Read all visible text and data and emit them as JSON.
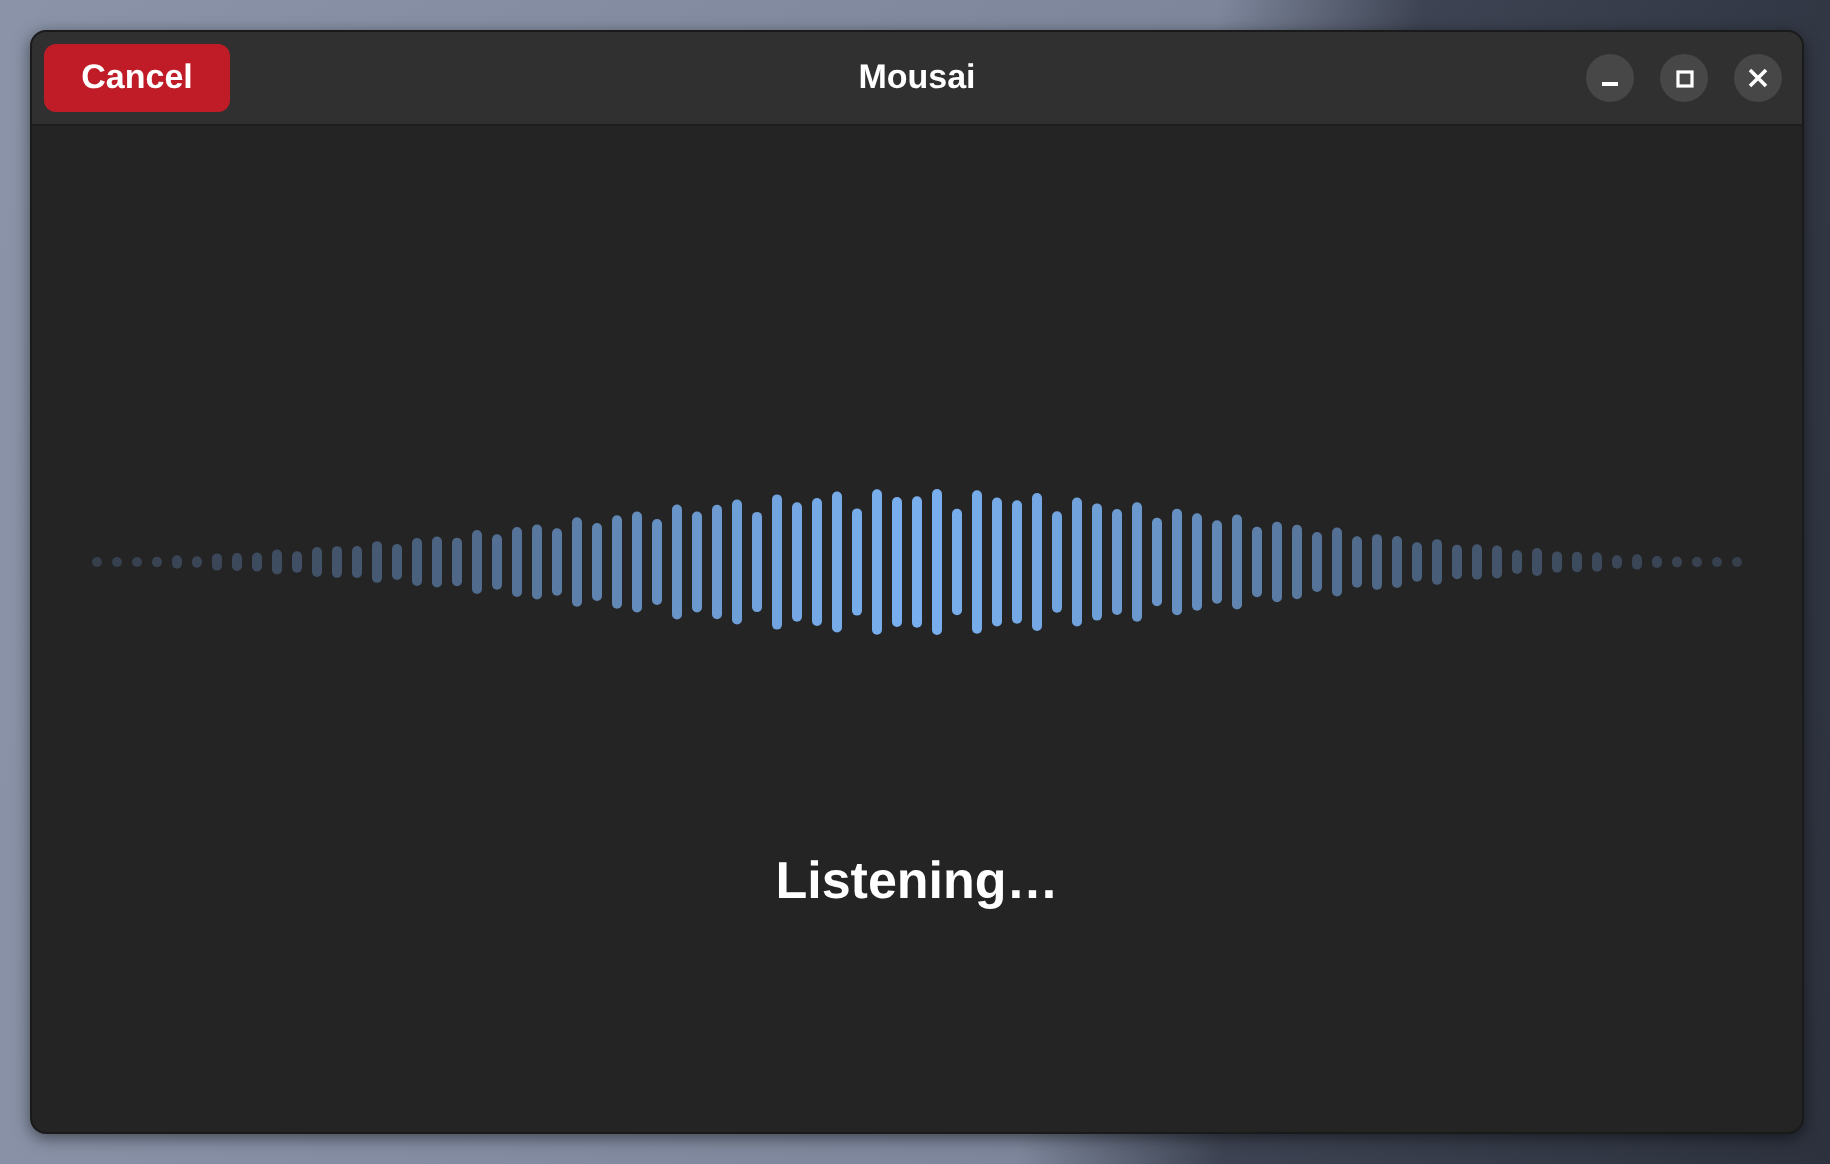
{
  "window": {
    "title": "Mousai"
  },
  "header": {
    "cancel_button": "Cancel"
  },
  "status": {
    "text": "Listening…"
  }
}
